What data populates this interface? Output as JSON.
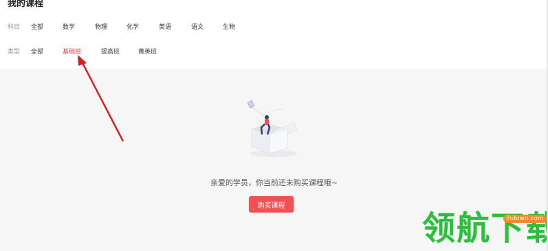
{
  "page": {
    "title": "我的课程"
  },
  "filters": {
    "subject": {
      "label": "科目",
      "options": [
        "全部",
        "数学",
        "物理",
        "化学",
        "英语",
        "语文",
        "生物"
      ]
    },
    "type": {
      "label": "类型",
      "options": [
        "全部",
        "基础班",
        "提高班",
        "菁英班"
      ],
      "selected": "基础班"
    }
  },
  "empty_state": {
    "message": "亲爱的学员，你当前还未购买课程哦~",
    "button_label": "购买课程"
  },
  "watermark": {
    "brand": "领航下载",
    "url": "lhdown.com"
  },
  "colors": {
    "accent": "#ef5157",
    "annotation_arrow": "#d42222",
    "watermark_green": "#2bbf3c"
  }
}
